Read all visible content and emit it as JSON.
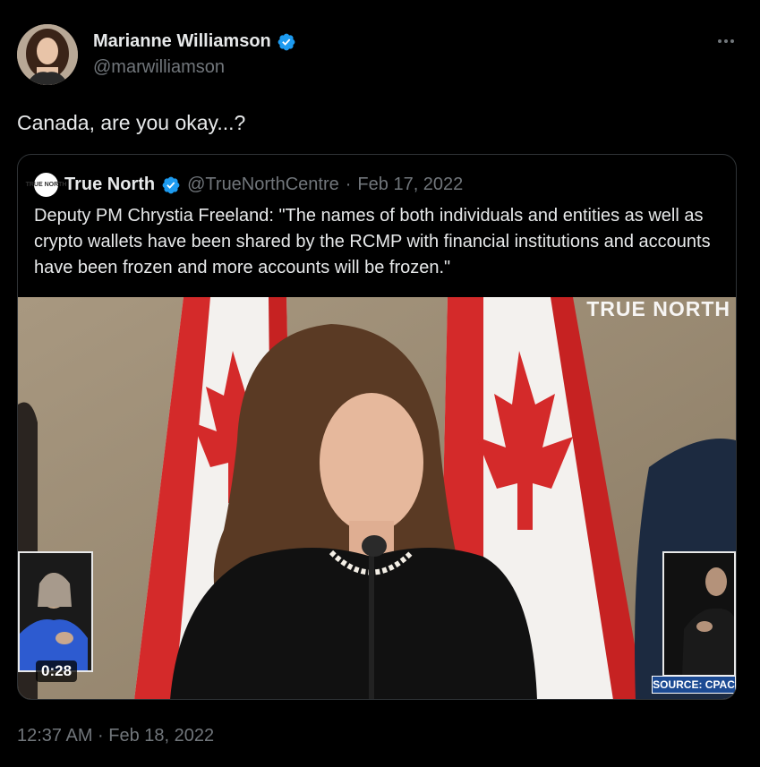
{
  "author": {
    "name": "Marianne Williamson",
    "handle": "@marwilliamson",
    "verified": true
  },
  "tweet": {
    "text": "Canada, are you okay...?",
    "timestamp": "12:37 AM · Feb 18, 2022"
  },
  "quoted": {
    "avatar_text": "TRUE NORTH",
    "name": "True North",
    "handle": "@TrueNorthCentre",
    "separator": "·",
    "date": "Feb 17, 2022",
    "text": "Deputy PM Chrystia Freeland: \"The names of both individuals and entities as well as crypto wallets have been shared by the RCMP with financial institutions and accounts have been frozen and more accounts will be frozen.\"",
    "media": {
      "watermark": "TRUE NORTH",
      "duration": "0:28",
      "source_label": "SOURCE: CPAC"
    }
  },
  "colors": {
    "background": "#000000",
    "text": "#e7e9ea",
    "secondary": "#71767b",
    "verified": "#1d9bf0",
    "border": "#2f3336"
  },
  "icons": {
    "verified": "verified-badge-icon",
    "more": "more-horizontal-icon"
  }
}
